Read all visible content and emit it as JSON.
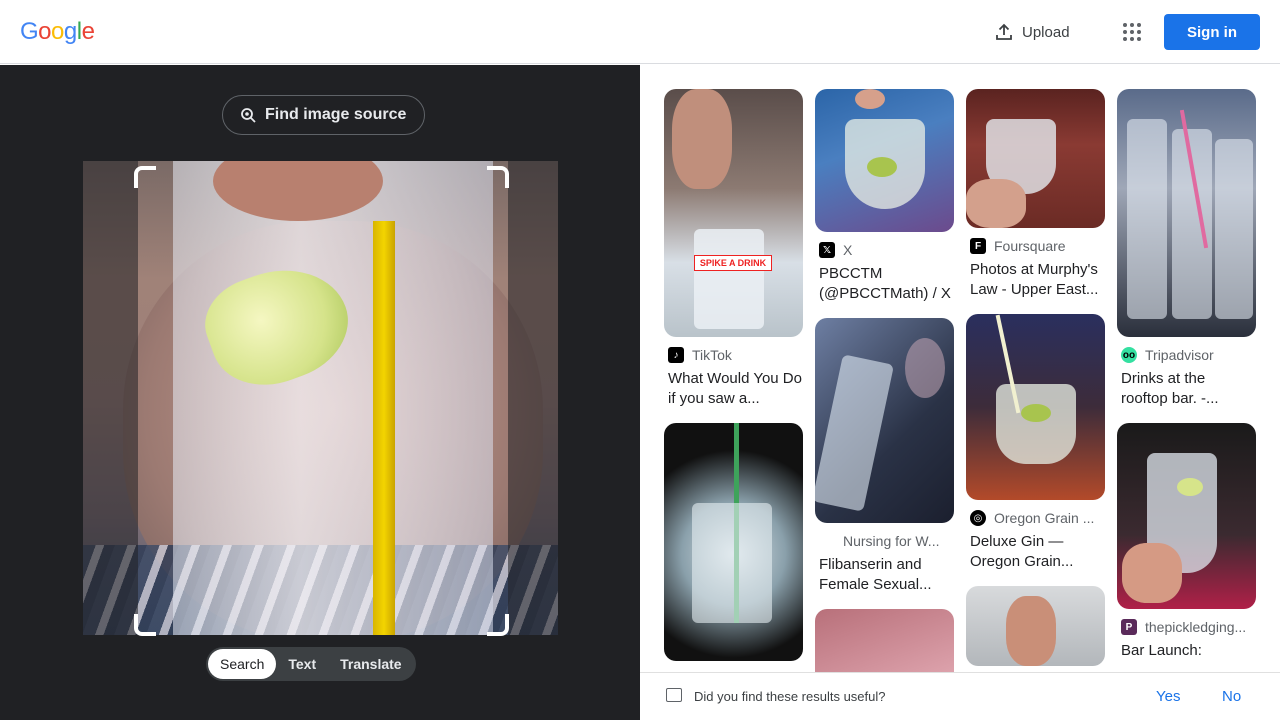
{
  "header": {
    "logo_letters": [
      "G",
      "o",
      "o",
      "g",
      "l",
      "e"
    ],
    "logo_colors": [
      "#4285F4",
      "#EA4335",
      "#FBBC05",
      "#4285F4",
      "#34A853",
      "#EA4335"
    ],
    "upload_label": "Upload",
    "signin_label": "Sign in"
  },
  "left": {
    "find_source_label": "Find image source",
    "tabs": [
      {
        "label": "Search",
        "active": true
      },
      {
        "label": "Text",
        "active": false
      },
      {
        "label": "Translate",
        "active": false
      }
    ]
  },
  "results": {
    "col1": [
      {
        "source": "TikTok",
        "title": "What Would You Do if you saw a...",
        "overlay_text": "SPIKE A DRINK"
      },
      {
        "source": "",
        "title": ""
      }
    ],
    "col2": [
      {
        "source": "X",
        "title": "PBCCTM (@PBCCTMath) / X"
      },
      {
        "source": "Nursing for W...",
        "title": "Flibanserin and Female Sexual..."
      }
    ],
    "col3": [
      {
        "source": "Foursquare",
        "title": "Photos at Murphy's Law - Upper East..."
      },
      {
        "source": "Oregon Grain ...",
        "title": "Deluxe Gin — Oregon Grain..."
      }
    ],
    "col4": [
      {
        "source": "Tripadvisor",
        "title": "Drinks at the rooftop bar. -..."
      },
      {
        "source": "thepickledging...",
        "title": "Bar Launch:"
      }
    ]
  },
  "feedback": {
    "question": "Did you find these results useful?",
    "yes": "Yes",
    "no": "No"
  }
}
